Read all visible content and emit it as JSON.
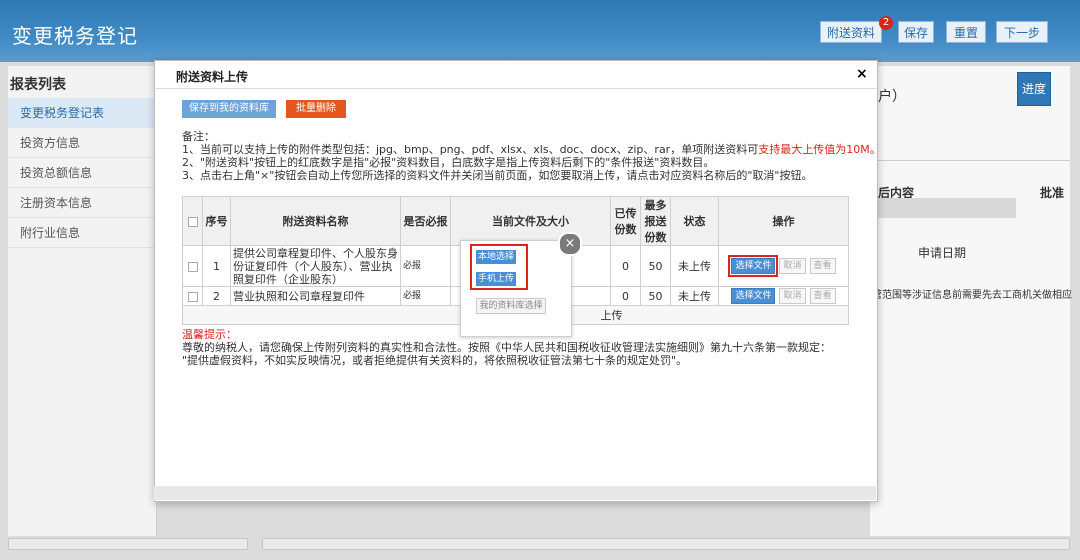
{
  "header": {
    "title": "变更税务登记",
    "buttons": {
      "attachments": "附送资料",
      "save": "保存",
      "reset": "重置",
      "next": "下一步"
    },
    "badge_count": "2"
  },
  "sidebar": {
    "title": "报表列表",
    "items": [
      {
        "label": "变更税务登记表"
      },
      {
        "label": "投资方信息"
      },
      {
        "label": "投资总额信息"
      },
      {
        "label": "注册资本信息"
      },
      {
        "label": "附行业信息"
      }
    ]
  },
  "right_panel": {
    "progress_button": "进度",
    "fragment_title": "户）",
    "col_after": "后内容",
    "col_approve": "批准",
    "apply_date": "申请日期",
    "note_text": "营范围等涉证信息前需要先去工商机关做相应"
  },
  "modal": {
    "title": "附送资料上传",
    "close": "×",
    "btn_save_lib": "保存到我的资料库",
    "btn_batch_delete": "批量删除",
    "notes_title": "备注：",
    "note1_prefix": "1、当前可以支持上传的附件类型包括：jpg、bmp、png、pdf、xlsx、xls、doc、docx、zip、rar，单项附送资料可",
    "note1_red": "支持最大上传值为10M。",
    "note2": "2、\"附送资料\"按钮上的红底数字是指\"必报\"资料数目，白底数字是指上传资料后剩下的\"条件报送\"资料数目。",
    "note3": "3、点击右上角\"×\"按钮会自动上传您所选择的资料文件并关闭当前页面，如您要取消上传，请点击对应资料名称后的\"取消\"按钮。",
    "table": {
      "headers": [
        "序号",
        "附送资料名称",
        "是否必报",
        "当前文件及大小",
        "已传份数",
        "最多报送份数",
        "状态",
        "操作"
      ],
      "rows": [
        {
          "index": "1",
          "name": "提供公司章程复印件、个人股东身份证复印件（个人股东）、营业执照复印件（企业股东）",
          "required": "必报",
          "file": "",
          "uploaded": "0",
          "max": "50",
          "status": "未上传"
        },
        {
          "index": "2",
          "name": "营业执照和公司章程复印件",
          "required": "必报",
          "file": "",
          "uploaded": "0",
          "max": "50",
          "status": "未上传"
        }
      ],
      "ops": {
        "select": "选择文件",
        "cancel": "取消",
        "view": "查看"
      },
      "footer_left": "该",
      "footer_right": "上传"
    },
    "popup": {
      "local": "本地选择",
      "mobile": "手机上传",
      "library": "我的资料库选择",
      "close": "×"
    },
    "warning_title": "温馨提示：",
    "warning_line1": "尊敬的纳税人，请您确保上传附列资料的真实性和合法性。按照《中华人民共和国税收征收管理法实施细则》第九十六条第一款规定：",
    "warning_line2": "\"提供虚假资料，不如实反映情况，或者拒绝提供有关资料的，将依照税收征管法第七十条的规定处罚\"。"
  },
  "colors": {
    "header_blue": "#2e78b5",
    "accent_red": "#d9261c",
    "batch_orange": "#e2571d",
    "button_blue": "#4a8fd6"
  }
}
